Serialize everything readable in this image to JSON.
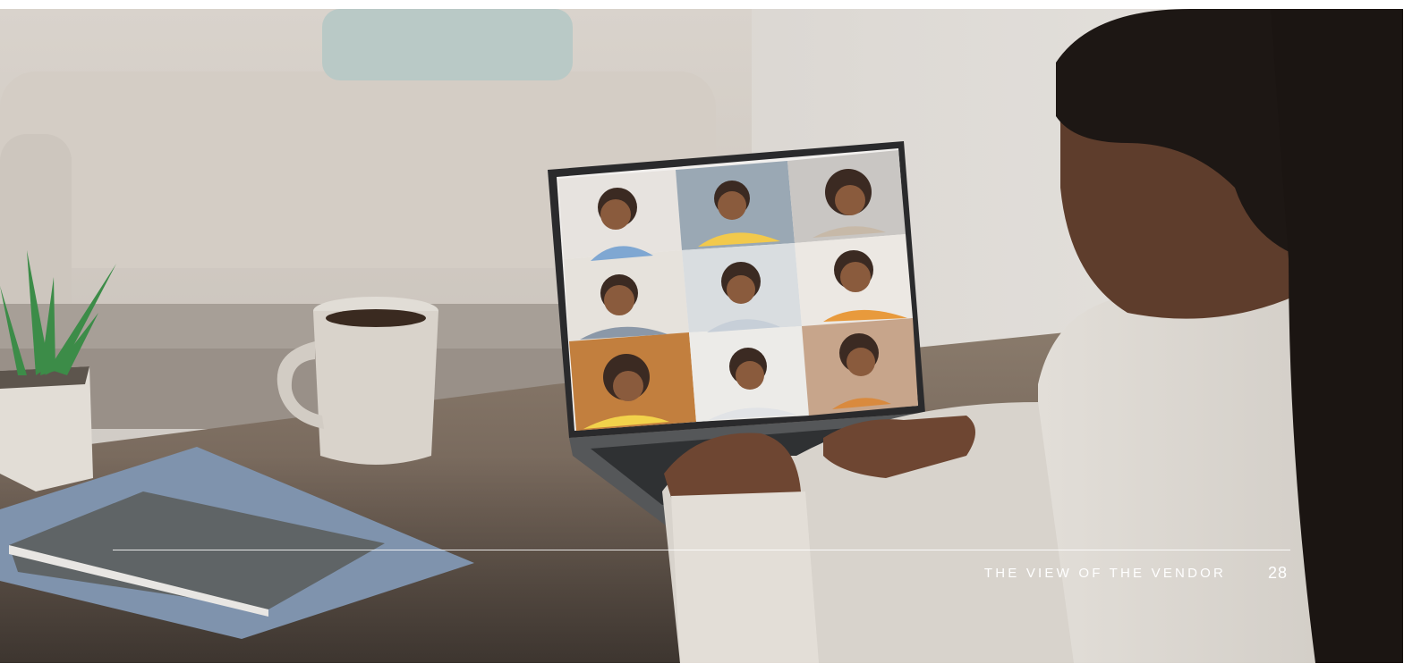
{
  "footer": {
    "section_title": "THE VIEW OF THE VENDOR",
    "page_number": "28"
  },
  "photo": {
    "subject": "video-conference-laptop-photo"
  }
}
